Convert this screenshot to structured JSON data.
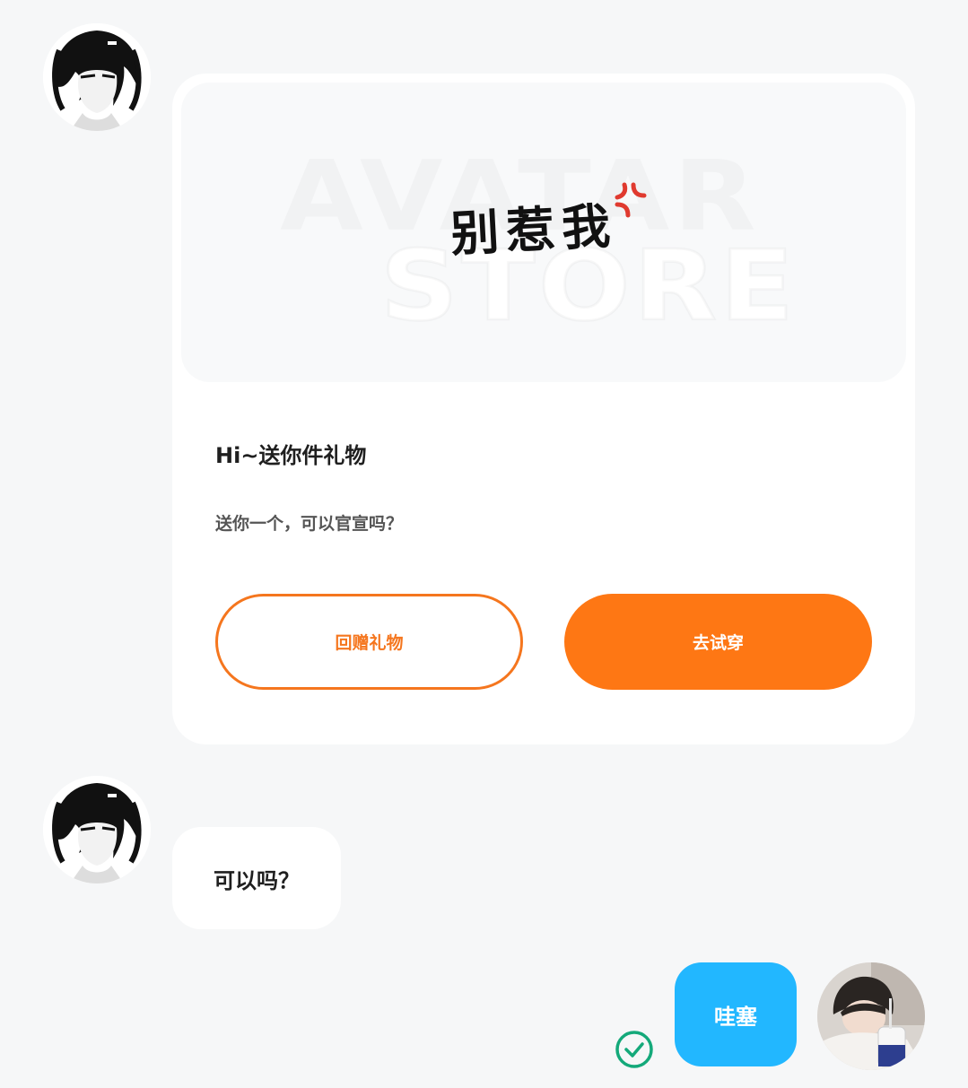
{
  "messages": {
    "gift_card": {
      "banner_watermark_line1": "AVATAR",
      "banner_watermark_line2": "STORE",
      "gift_item_text": "别惹我",
      "title": "Hi~送你件礼物",
      "subtitle": "送你一个，可以官宣吗？",
      "return_gift_label": "回赠礼物",
      "try_on_label": "去试穿"
    },
    "incoming_text": "可以吗？",
    "outgoing_text": "哇塞",
    "outgoing_status_icon": "check-circle-icon"
  },
  "colors": {
    "accent_orange": "#fe7714",
    "outgoing_bubble": "#22b7ff",
    "read_check": "#14a97a",
    "background": "#f6f7f8"
  }
}
